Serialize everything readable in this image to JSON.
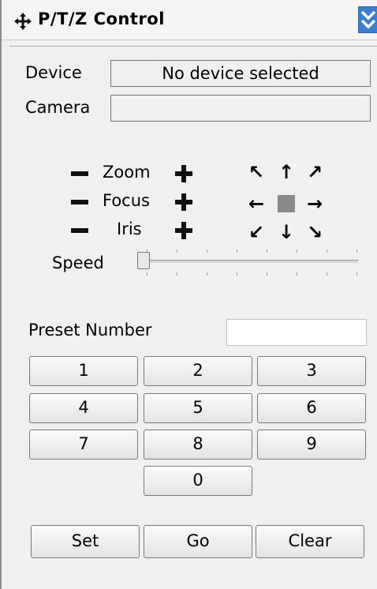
{
  "window": {
    "title": "P/T/Z Control"
  },
  "device": {
    "label": "Device",
    "value": "No device selected"
  },
  "camera": {
    "label": "Camera",
    "value": ""
  },
  "controls": {
    "zoom_label": "Zoom",
    "focus_label": "Focus",
    "iris_label": "Iris",
    "speed_label": "Speed",
    "speed_value": 0
  },
  "arrows": {
    "up_left": "↖",
    "up": "↑",
    "up_right": "↗",
    "left": "←",
    "right": "→",
    "down_left": "↙",
    "down": "↓",
    "down_right": "↘"
  },
  "preset": {
    "label": "Preset Number",
    "value": "",
    "keys": [
      "1",
      "2",
      "3",
      "4",
      "5",
      "6",
      "7",
      "8",
      "9",
      "0"
    ]
  },
  "actions": {
    "set": "Set",
    "go": "Go",
    "clear": "Clear"
  },
  "colors": {
    "accent": "#3b7fd0",
    "panel": "#f0f0f0"
  }
}
